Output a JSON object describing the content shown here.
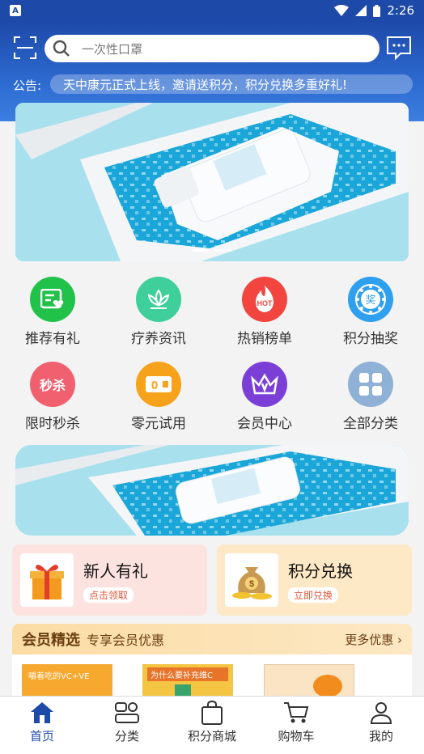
{
  "status_bar": {
    "time": "2:26",
    "app_icon_letter": "A"
  },
  "header": {
    "search_placeholder": "一次性口罩",
    "notice_label": "公告:",
    "notice_text": "天中康元正式上线，邀请送积分，积分兑换多重好礼!"
  },
  "grid": [
    {
      "label": "推荐有礼",
      "icon": "gift-card-icon",
      "color": "#21c24a"
    },
    {
      "label": "疗养资讯",
      "icon": "lotus-icon",
      "color": "#3fcf9a"
    },
    {
      "label": "热销榜单",
      "icon": "hot-flame-icon",
      "color": "#f3453f"
    },
    {
      "label": "积分抽奖",
      "icon": "lottery-wheel-icon",
      "color": "#2f9ff0"
    },
    {
      "label": "限时秒杀",
      "icon": "flash-sale-icon",
      "color": "#f1606e",
      "badge": "秒杀"
    },
    {
      "label": "零元试用",
      "icon": "free-trial-icon",
      "color": "#f7a21b",
      "badge": "0"
    },
    {
      "label": "会员中心",
      "icon": "crown-icon",
      "color": "#7b3fd8"
    },
    {
      "label": "全部分类",
      "icon": "categories-icon",
      "color": "#8fb1d6"
    }
  ],
  "hot_badge": "HOT",
  "lottery_badge": "奖",
  "cards": {
    "new_user": {
      "title": "新人有礼",
      "button": "点击领取"
    },
    "points": {
      "title": "积分兑换",
      "button": "立即兑换"
    }
  },
  "picks": {
    "title": "会员精选",
    "subtitle": "专享会员优惠",
    "more": "更多优惠",
    "items": [
      {
        "caption": "嚼着吃的VC+VE"
      },
      {
        "caption": "为什么要补充维C"
      },
      {
        "caption": ""
      }
    ]
  },
  "tabbar": [
    {
      "label": "首页",
      "active": true
    },
    {
      "label": "分类"
    },
    {
      "label": "积分商城"
    },
    {
      "label": "购物车"
    },
    {
      "label": "我的"
    }
  ],
  "colors": {
    "primary": "#1d49a9",
    "accent": "#e2573b"
  }
}
